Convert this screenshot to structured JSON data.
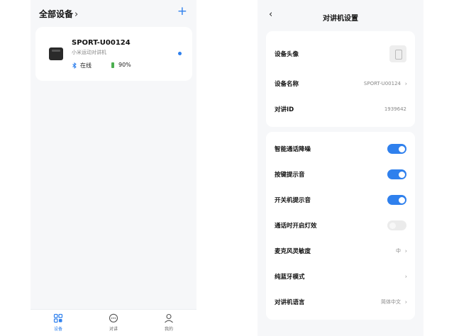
{
  "devices_screen": {
    "header": {
      "title": "全部设备",
      "chevron_icon": "chevron-right-icon",
      "add_icon": "plus-icon"
    },
    "device": {
      "name": "SPORT-U00124",
      "subtitle": "小米运动对讲机",
      "status": "在线",
      "battery": "90%",
      "battery_level": 0.9,
      "online_dot_color": "#2f80ed"
    },
    "tabs": [
      {
        "label": "设备",
        "icon": "grid-icon",
        "active": true
      },
      {
        "label": "对讲",
        "icon": "chat-bubble-icon",
        "active": false
      },
      {
        "label": "我的",
        "icon": "person-icon",
        "active": false
      }
    ]
  },
  "settings_screen": {
    "header": {
      "title": "对讲机设置",
      "back_icon": "chevron-left-icon"
    },
    "info_rows": [
      {
        "label": "设备头像",
        "value": ""
      },
      {
        "label": "设备名称",
        "value": "SPORT-U00124"
      },
      {
        "label": "对讲ID",
        "value": "1939642"
      }
    ],
    "settings_rows": [
      {
        "label": "智能通话降噪",
        "type": "toggle",
        "on": true
      },
      {
        "label": "按键提示音",
        "type": "toggle",
        "on": true
      },
      {
        "label": "开关机提示音",
        "type": "toggle",
        "on": true
      },
      {
        "label": "通话时开启灯效",
        "type": "toggle",
        "on": false
      },
      {
        "label": "麦克风灵敏度",
        "type": "select",
        "value": "中"
      },
      {
        "label": "纯蓝牙模式",
        "type": "link",
        "value": ""
      },
      {
        "label": "对讲机语言",
        "type": "select",
        "value": "简体中文"
      }
    ]
  },
  "colors": {
    "accent": "#2f80ed",
    "background": "#f6f7f9",
    "card": "#ffffff",
    "battery": "#4caf50"
  }
}
